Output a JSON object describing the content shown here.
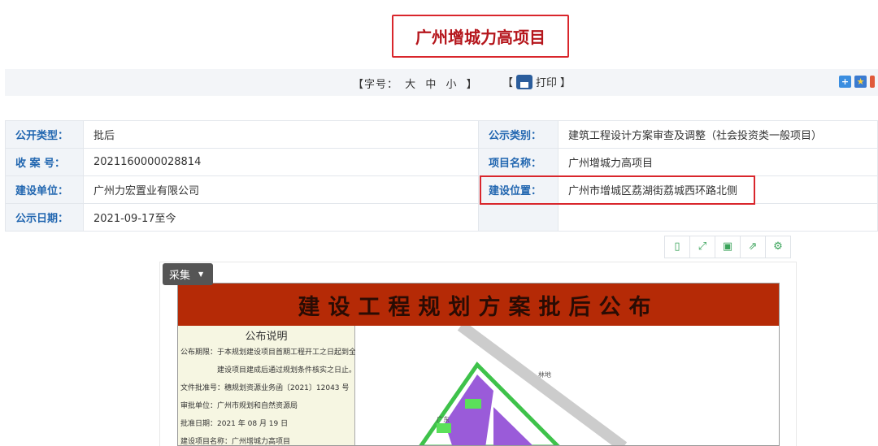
{
  "title": "广州增城力高项目",
  "toolbar": {
    "font_label": "【字号：",
    "large": "大",
    "medium": "中",
    "small": "小",
    "font_close": "】",
    "print_open": "【",
    "print": "打印",
    "print_close": "】"
  },
  "info": {
    "rows": [
      {
        "l1": "公开类型：",
        "v1": "批后",
        "l2": "公示类别：",
        "v2": "建筑工程设计方案审查及调整（社会投资类一般项目）"
      },
      {
        "l1": "收 案 号：",
        "v1": "2021160000028814",
        "l2": "项目名称：",
        "v2": "广州增城力高项目"
      },
      {
        "l1": "建设单位：",
        "v1": "广州力宏置业有限公司",
        "l2": "建设位置：",
        "v2": "广州市增城区荔湖街荔城西环路北侧"
      },
      {
        "l1": "公示日期：",
        "v1": "2021-09-17至今",
        "l2": "",
        "v2": ""
      }
    ]
  },
  "viewer": {
    "collect": "采集"
  },
  "poster": {
    "banner": "建设工程规划方案批后公布",
    "notice_title": "公布说明",
    "lines": [
      "公布期限：于本规划建设项目首期工程开工之日起到全部",
      "建设项目建成后通过规划条件核实之日止。",
      "文件批准号：穗规划资源业务函〔2021〕12043 号",
      "审批单位：广州市规划和自然资源局",
      "批准日期：2021 年 08 月 19 日",
      "建设项目名称：广州增城力高项目"
    ],
    "map_labels": [
      "林地",
      "广东"
    ]
  }
}
